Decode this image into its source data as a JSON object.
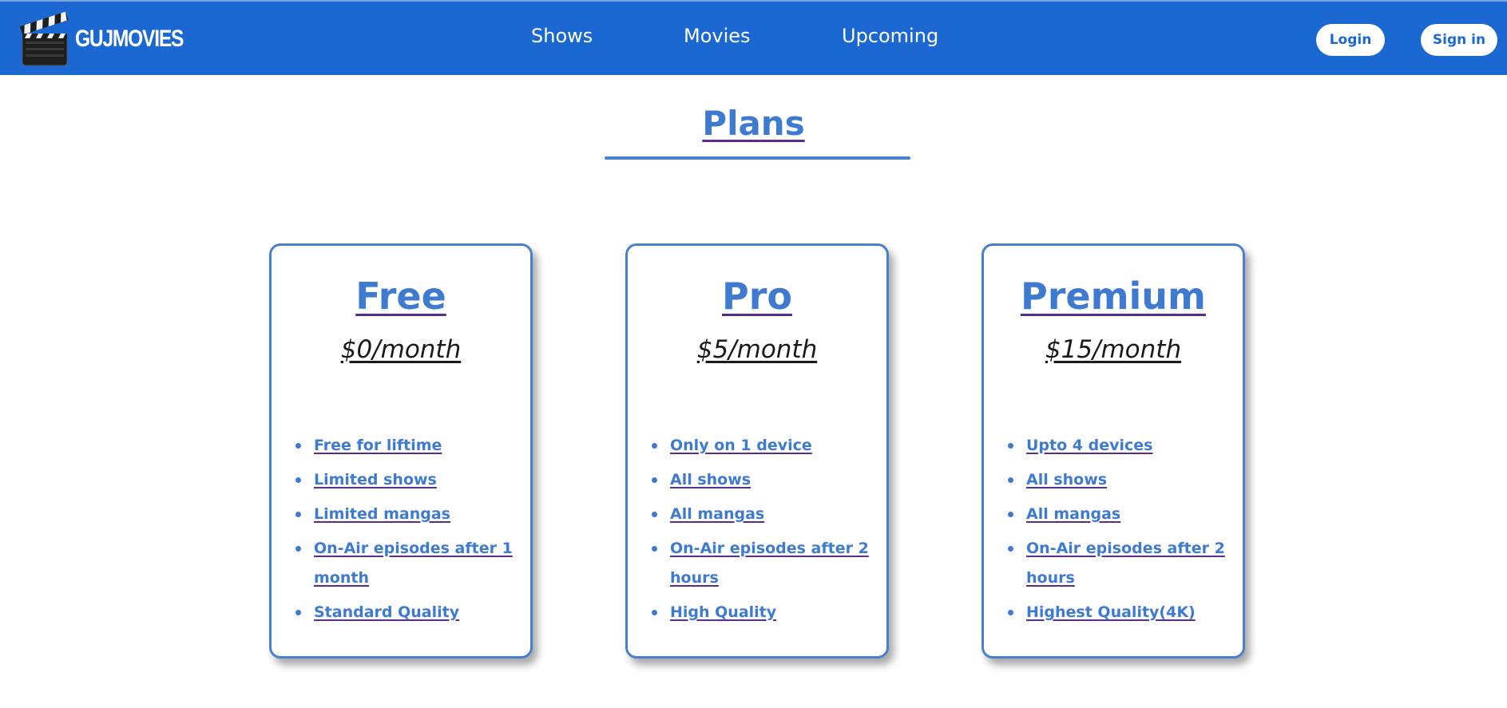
{
  "navbar": {
    "brand": "GUJMOVIES",
    "links": [
      "Shows",
      "Movies",
      "Upcoming"
    ],
    "login_label": "Login",
    "signin_label": "Sign in",
    "bg_color": "#1b68d2"
  },
  "page": {
    "title": "Plans",
    "accent_color": "#3e7bd0"
  },
  "plans": [
    {
      "name": "Free",
      "price": "$0/month",
      "features": [
        "Free for liftime",
        "Limited shows",
        "Limited mangas",
        "On-Air episodes after 1 month",
        "Standard Quality"
      ]
    },
    {
      "name": "Pro",
      "price": "$5/month",
      "features": [
        "Only on 1 device",
        "All shows",
        "All mangas",
        "On-Air episodes after 2 hours",
        "High Quality"
      ]
    },
    {
      "name": "Premium",
      "price": "$15/month",
      "features": [
        "Upto 4 devices",
        "All shows",
        "All mangas",
        "On-Air episodes after 2 hours",
        "Highest Quality(4K)"
      ]
    }
  ]
}
